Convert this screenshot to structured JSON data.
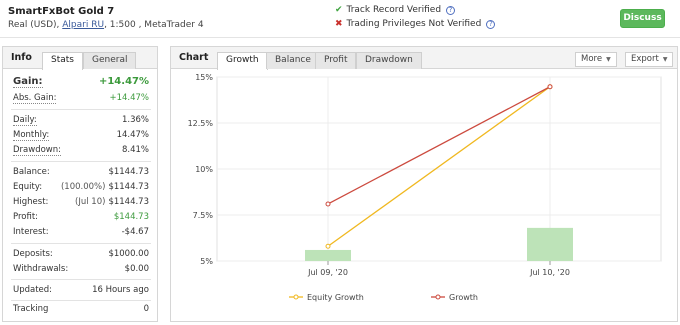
{
  "header": {
    "account_name": "SmartFxBot Gold 7",
    "account_type": "Real (USD),",
    "broker": "Alpari RU",
    "leverage_platform": ", 1:500 , MetaTrader 4",
    "track_record": "Track Record Verified",
    "trading_privileges": "Trading Privileges Not Verified",
    "discuss_label": "Discuss",
    "colors": {
      "verified": "#3fa43f",
      "not_verified": "#c9302c",
      "discuss_bg": "#5cb85c"
    }
  },
  "info_panel": {
    "title": "Info",
    "tabs": [
      {
        "label": "Stats",
        "active": true
      },
      {
        "label": "General",
        "active": false
      }
    ],
    "gain": {
      "label": "Gain:",
      "value": "+14.47%"
    },
    "abs_gain": {
      "label": "Abs. Gain:",
      "value": "+14.47%"
    },
    "daily": {
      "label": "Daily:",
      "value": "1.36%"
    },
    "monthly": {
      "label": "Monthly:",
      "value": "14.47%"
    },
    "drawdown": {
      "label": "Drawdown:",
      "value": "8.41%"
    },
    "balance": {
      "label": "Balance:",
      "value": "$1144.73"
    },
    "equity": {
      "label": "Equity:",
      "prefix": "(100.00%)",
      "value": "$1144.73"
    },
    "highest": {
      "label": "Highest:",
      "prefix": "(Jul 10)",
      "value": "$1144.73"
    },
    "profit": {
      "label": "Profit:",
      "value": "$144.73"
    },
    "interest": {
      "label": "Interest:",
      "value": "-$4.67"
    },
    "deposits": {
      "label": "Deposits:",
      "value": "$1000.00"
    },
    "withdrawals": {
      "label": "Withdrawals:",
      "value": "$0.00"
    },
    "updated": {
      "label": "Updated:",
      "value": "16 Hours ago"
    },
    "tracking": {
      "label": "Tracking",
      "value": "0"
    }
  },
  "chart_panel": {
    "title": "Chart",
    "tabs": [
      {
        "label": "Growth",
        "active": true
      },
      {
        "label": "Balance",
        "active": false
      },
      {
        "label": "Profit",
        "active": false
      },
      {
        "label": "Drawdown",
        "active": false
      }
    ],
    "more_label": "More",
    "export_label": "Export"
  },
  "chart_data": {
    "type": "line",
    "categories": [
      "Jul 09, '20",
      "Jul 10, '20"
    ],
    "y_ticks": [
      "15%",
      "12.5%",
      "10%",
      "7.5%",
      "5%"
    ],
    "ylim": [
      5,
      15
    ],
    "series": [
      {
        "name": "Equity Growth",
        "type": "line",
        "color": "#f0b820",
        "values": [
          5.8,
          14.47
        ]
      },
      {
        "name": "Growth",
        "type": "line",
        "color": "#cc4a3e",
        "values": [
          8.1,
          14.47
        ]
      }
    ],
    "bars": {
      "color": "#bde3b8",
      "values": [
        5.6,
        6.8
      ]
    },
    "grid": true,
    "legend_position": "bottom"
  }
}
